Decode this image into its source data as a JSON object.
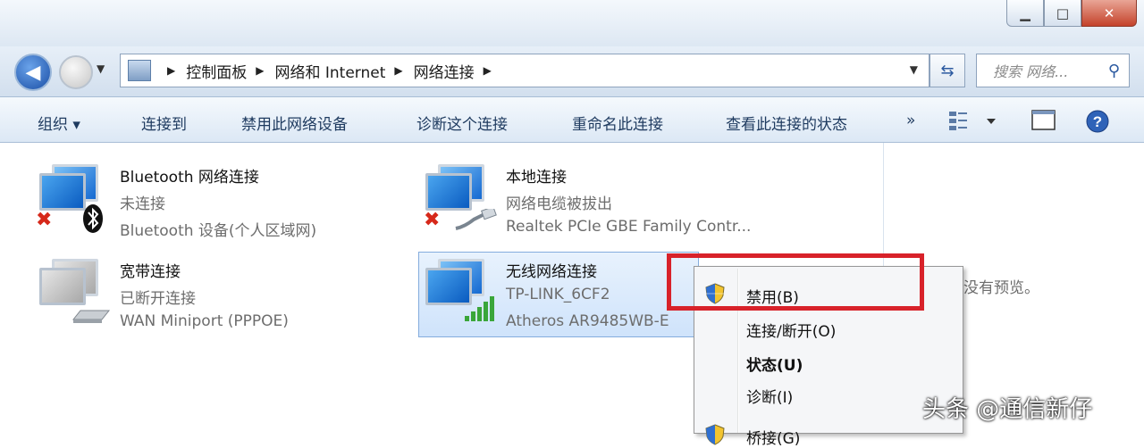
{
  "window": {
    "minimize": "▁",
    "maximize": "□",
    "close": "✕"
  },
  "nav": {
    "back_icon": "arrow-left-icon",
    "crumbs": [
      "控制面板",
      "网络和 Internet",
      "网络连接"
    ],
    "search_placeholder": "搜索 网络..."
  },
  "toolbar": {
    "organize": "组织 ▾",
    "connect_to": "连接到",
    "disable": "禁用此网络设备",
    "diagnose": "诊断这个连接",
    "rename": "重命名此连接",
    "view_status": "查看此连接的状态",
    "more": "»"
  },
  "connections": [
    {
      "name": "Bluetooth 网络连接",
      "status": "未连接",
      "device": "Bluetooth 设备(个人区域网)"
    },
    {
      "name": "本地连接",
      "status": "网络电缆被拔出",
      "device": "Realtek PCIe GBE Family Contr..."
    },
    {
      "name": "宽带连接",
      "status": "已断开连接",
      "device": "WAN Miniport (PPPOE)"
    },
    {
      "name": "无线网络连接",
      "status": "TP-LINK_6CF2",
      "device": "Atheros AR9485WB-E"
    }
  ],
  "context_menu": {
    "disable": "禁用(B)",
    "connect": "连接/断开(O)",
    "status": "状态(U)",
    "diagnose": "诊断(I)",
    "bridge": "桥接(G)"
  },
  "preview_text": "没有预览。",
  "watermark": "头条 @通信新仔",
  "colors": {
    "highlight_box": "#d8222a",
    "selection": "#cfe3fb"
  }
}
